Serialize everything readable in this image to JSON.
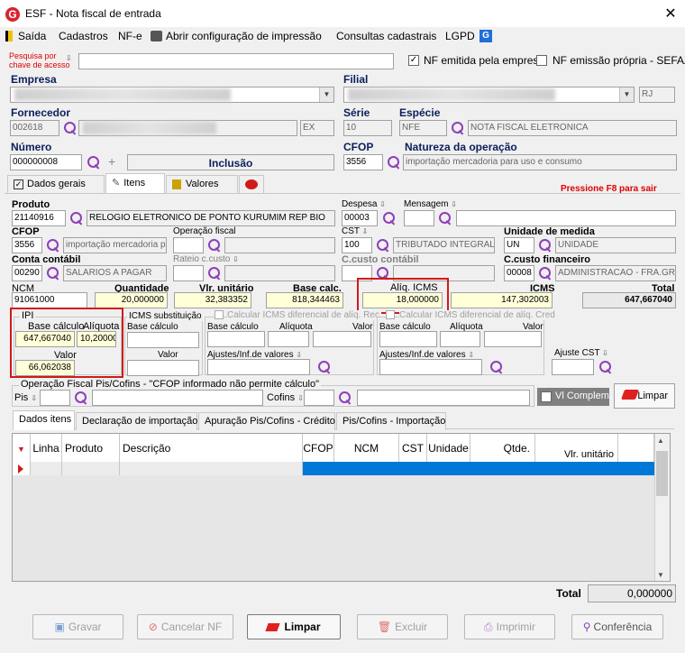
{
  "window": {
    "title": "ESF - Nota fiscal de entrada",
    "logo": "G"
  },
  "menu": [
    "Saída",
    "Cadastros",
    "NF-e",
    "Abrir configuração de impressão",
    "Consultas cadastrais",
    "LGPD"
  ],
  "search": {
    "label1": "Pesquisa por",
    "label2": "chave de acesso",
    "value": ""
  },
  "nf_emitida": {
    "label": "NF emitida pela empresa",
    "checked": true
  },
  "nf_propria": {
    "label": "NF emissão própria - SEFAZ",
    "checked": false
  },
  "empresa": {
    "label": "Empresa"
  },
  "filial": {
    "label": "Filial",
    "uf": "RJ"
  },
  "fornecedor": {
    "label": "Fornecedor",
    "code": "002618",
    "type": "EX"
  },
  "serie": {
    "label": "Série",
    "value": "10"
  },
  "especie": {
    "label": "Espécie",
    "code": "NFE",
    "desc": "NOTA FISCAL ELETRONICA"
  },
  "numero": {
    "label": "Número",
    "value": "000000008",
    "status": "Inclusão"
  },
  "cfop_header": {
    "label": "CFOP",
    "value": "3556"
  },
  "natureza": {
    "label": "Natureza da operação",
    "value": "importação mercadoria para uso e consumo"
  },
  "tabs": [
    "Dados gerais",
    "Itens",
    "Valores"
  ],
  "hint": "Pressione F8 para sair",
  "item": {
    "produto_label": "Produto",
    "produto_code": "21140916",
    "produto_desc": "RELOGIO ELETRONICO DE PONTO KURUMIM REP BIO",
    "despesa_label": "Despesa",
    "despesa_value": "00003",
    "mensagem_label": "Mensagem",
    "cfop_label": "CFOP",
    "cfop_code": "3556",
    "cfop_desc": "importação mercadoria pa",
    "operacao_label": "Operação fiscal",
    "cst_label": "CST",
    "cst_code": "100",
    "cst_desc": "TRIBUTADO INTEGRALM",
    "unidade_label": "Unidade de medida",
    "unidade_code": "UN",
    "unidade_desc": "UNIDADE",
    "conta_label": "Conta contábil",
    "conta_code": "00290",
    "conta_desc": "SALARIOS A PAGAR",
    "rateio_label": "Rateio c.custo",
    "ccusto_label": "C.custo contábil",
    "ccfin_label": "C.custo financeiro",
    "ccfin_code": "00008",
    "ccfin_desc": "ADMINISTRACAO - FRA.GRU",
    "ncm_label": "NCM",
    "ncm_value": "91061000",
    "quantidade_label": "Quantidade",
    "quantidade_value": "20,000000",
    "vlr_unit_label": "Vlr. unitário",
    "vlr_unit_value": "32,383352",
    "base_calc_label": "Base calc.",
    "base_calc_value": "818,344463",
    "aliq_icms_label": "Alíq. ICMS",
    "aliq_icms_value": "18,000000",
    "icms_label": "ICMS",
    "icms_value": "147,302003",
    "total_label": "Total",
    "total_value": "647,667040"
  },
  "ipi": {
    "title": "IPI",
    "base_label": "Base cálculo",
    "aliq_label": "Alíquota",
    "base_value": "647,667040",
    "aliq_value": "10,200000",
    "valor_label": "Valor",
    "valor_value": "66,062038"
  },
  "icms_st": {
    "title": "ICMS substituição",
    "base_label": "Base cálculo",
    "valor_label": "Valor"
  },
  "icms_dif1": {
    "title": "Calcular ICMS diferencial de alíq. Rec",
    "base_label": "Base cálculo",
    "aliq_label": "Alíquota",
    "valor_label": "Valor",
    "ajustes_label": "Ajustes/Inf.de valores"
  },
  "icms_dif2": {
    "title": "Calcular ICMS diferencial de alíq. Cred",
    "base_label": "Base cálculo",
    "aliq_label": "Alíquota",
    "valor_label": "Valor",
    "ajustes_label": "Ajustes/Inf.de valores"
  },
  "ajuste_cst": {
    "label": "Ajuste CST"
  },
  "pis_cofins": {
    "title": "Operação Fiscal Pis/Cofins - \"CFOP informado não permite cálculo\"",
    "pis_label": "Pis",
    "cofins_label": "Cofins"
  },
  "vl_complem": {
    "label": "Vl Complem."
  },
  "limpar_small": "Limpar",
  "subtabs": [
    "Dados itens",
    "Declaração de importação",
    "Apuração Pis/Cofins - Crédito",
    "Pis/Cofins - Importação"
  ],
  "grid": {
    "columns": [
      "Linha",
      "Produto",
      "Descrição",
      "CFOP",
      "NCM",
      "CST",
      "Unidade",
      "Qtde.",
      "Vlr. unitário"
    ]
  },
  "total_footer": {
    "label": "Total",
    "value": "0,000000"
  },
  "buttons": {
    "gravar": "Gravar",
    "cancelar": "Cancelar NF",
    "limpar": "Limpar",
    "excluir": "Excluir",
    "imprimir": "Imprimir",
    "conferencia": "Conferência"
  },
  "colors": {
    "accent_red": "#d11a1a",
    "blue_label": "#0b1f5a",
    "selection_blue": "#0078d7",
    "lookup_purple": "#8e3fb8"
  }
}
